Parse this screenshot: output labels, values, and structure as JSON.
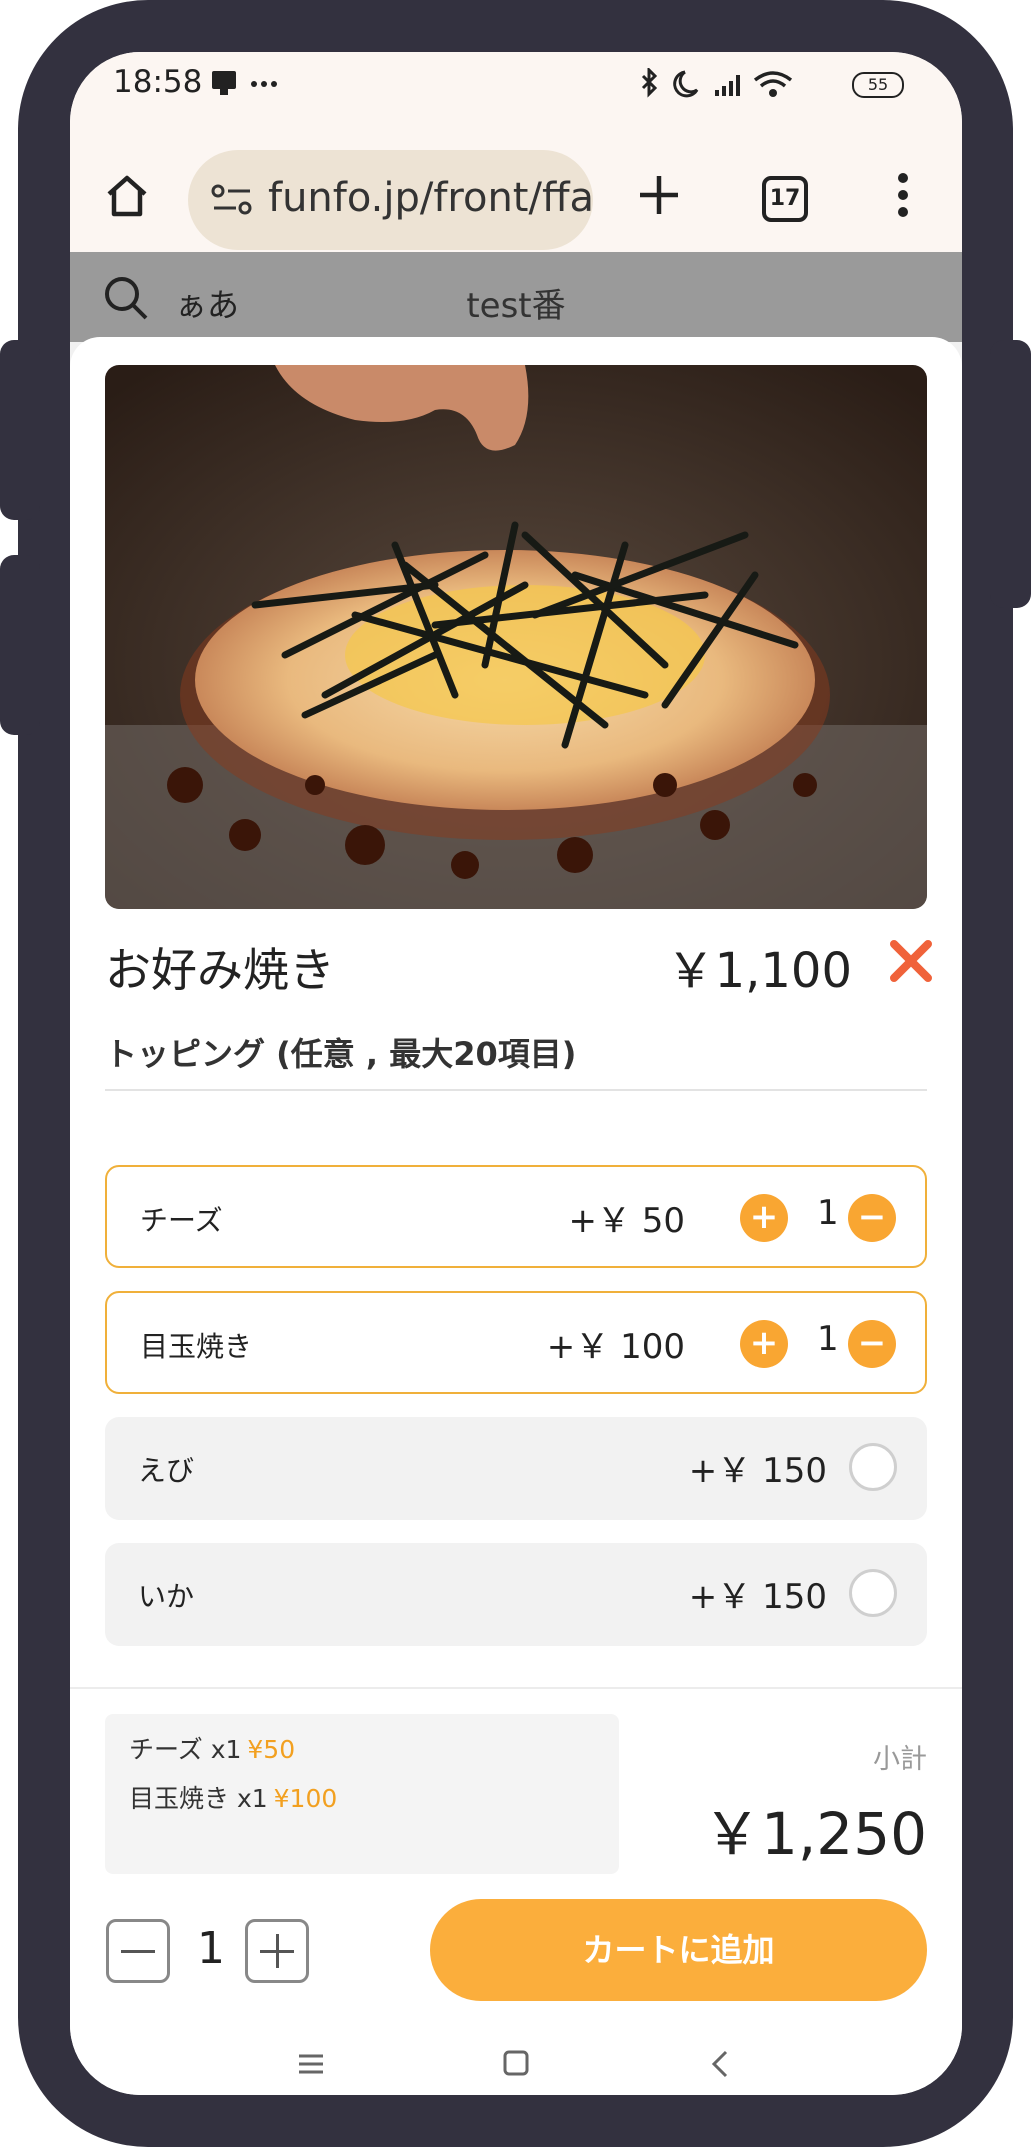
{
  "status": {
    "time": "18:58",
    "battery": "55"
  },
  "browser": {
    "url": "funfo.jp/front/ffap",
    "tab_count": "17"
  },
  "page_header": {
    "lang": "ぁあ",
    "title": "test番"
  },
  "item": {
    "name": "お好み焼き",
    "price": "￥1,100"
  },
  "toppings": {
    "section_title": "トッピング (任意 , 最大20項目)",
    "items": [
      {
        "name": "チーズ",
        "price": "+￥ 50",
        "qty": "1",
        "selected": true
      },
      {
        "name": "目玉焼き",
        "price": "+￥ 100",
        "qty": "1",
        "selected": true
      },
      {
        "name": "えび",
        "price": "+￥ 150",
        "selected": false
      },
      {
        "name": "いか",
        "price": "+￥ 150",
        "selected": false
      }
    ]
  },
  "summary": {
    "lines": [
      {
        "text": "チーズ x1",
        "price": "¥50"
      },
      {
        "text": "目玉焼き x1",
        "price": "¥100"
      }
    ],
    "subtotal_label": "小計",
    "subtotal_value": "￥1,250"
  },
  "order": {
    "quantity": "1",
    "add_to_cart": "カートに追加"
  },
  "colors": {
    "accent": "#f9a632",
    "close": "#f0623a",
    "frame": "#33313f"
  }
}
